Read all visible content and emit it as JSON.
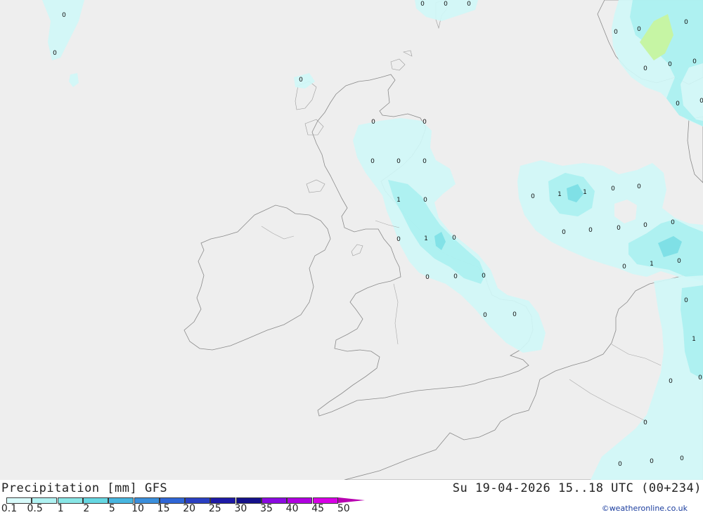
{
  "map": {
    "title": "Precipitation [mm] GFS",
    "timestamp": "Su 19-04-2026 15..18 UTC (00+234)",
    "credit": "©weatheronline.co.uk",
    "colors": {
      "sea": "#eeeeee",
      "land": "#c6f5a4",
      "precip_low": "#d0f7f7",
      "precip_mid": "#aaf0f0",
      "precip_high": "#7fe0e6",
      "coastline": "#8a8a8a"
    },
    "legend": {
      "ticks": [
        "0.1",
        "0.5",
        "1",
        "2",
        "5",
        "10",
        "15",
        "20",
        "25",
        "30",
        "35",
        "40",
        "45",
        "50"
      ],
      "colors": [
        "#d8fbfb",
        "#b0f2f2",
        "#88e6e6",
        "#66d7e2",
        "#48b6e0",
        "#3b8fdc",
        "#2f66d6",
        "#2a3fc2",
        "#1e1aa6",
        "#14108a",
        "#8a0ae0",
        "#b000e0",
        "#d800e6",
        "#b800b0"
      ]
    },
    "value_labels": [
      "0",
      "0",
      "0",
      "0",
      "0",
      "0",
      "0",
      "0",
      "0",
      "0",
      "0",
      "0",
      "0",
      "0",
      "0",
      "0",
      "0",
      "0",
      "0",
      "0",
      "1",
      "0",
      "1",
      "0",
      "1",
      "1",
      "0",
      "0",
      "0",
      "0",
      "0",
      "0",
      "0",
      "0",
      "0",
      "0",
      "0",
      "1",
      "0",
      "0",
      "1",
      "0",
      "0",
      "0",
      "0",
      "0",
      "0",
      "0"
    ]
  }
}
